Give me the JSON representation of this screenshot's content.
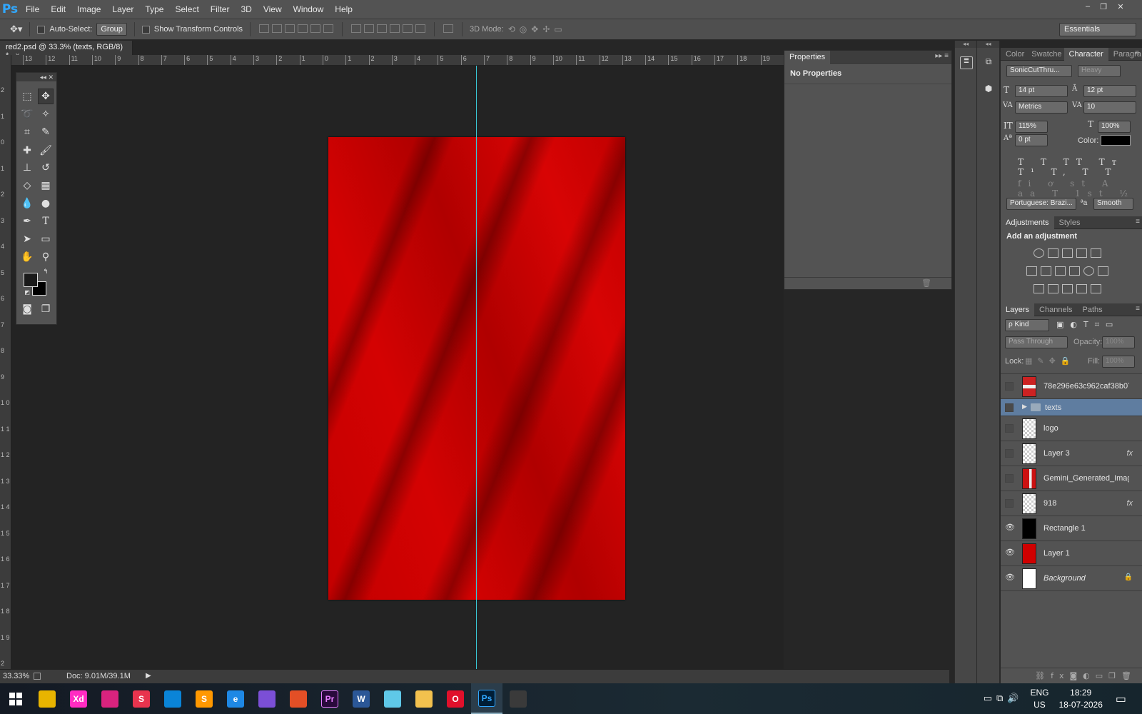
{
  "app": {
    "logo": "Ps"
  },
  "menu": [
    "File",
    "Edit",
    "Image",
    "Layer",
    "Type",
    "Select",
    "Filter",
    "3D",
    "View",
    "Window",
    "Help"
  ],
  "window_controls": {
    "minimize": "–",
    "restore": "❐",
    "close": "✕"
  },
  "options_bar": {
    "auto_select_label": "Auto-Select:",
    "auto_select_value": "Group",
    "show_transform_label": "Show Transform Controls",
    "mode_3d_label": "3D Mode:",
    "workspace": "Essentials"
  },
  "document_tab": {
    "title": "red2.psd @ 33.3% (texts, RGB/8) *",
    "close": "×"
  },
  "ruler_top": [
    "13",
    "12",
    "11",
    "10",
    "9",
    "8",
    "7",
    "6",
    "5",
    "4",
    "3",
    "2",
    "1",
    "0",
    "1",
    "2",
    "3",
    "4",
    "5",
    "6",
    "7",
    "8",
    "9",
    "10",
    "11",
    "12",
    "13",
    "14",
    "15",
    "16",
    "17",
    "18",
    "19"
  ],
  "ruler_left": [
    "2",
    "1",
    "0",
    "1",
    "2",
    "3",
    "4",
    "5",
    "6",
    "7",
    "8",
    "9",
    "1 0",
    "1 1",
    "1 2",
    "1 3",
    "1 4",
    "1 5",
    "1 6",
    "1 7",
    "1 8",
    "1 9",
    "2"
  ],
  "status": {
    "zoom": "33.33%",
    "doc": "Doc: 9.01M/39.1M"
  },
  "properties": {
    "tab": "Properties",
    "content": "No Properties"
  },
  "character_panel": {
    "tabs": [
      "Color",
      "Swatche",
      "Character",
      "Paragra"
    ],
    "font_family": "SonicCutThru...",
    "font_style": "Heavy",
    "font_size": "14 pt",
    "leading": "12 pt",
    "kerning": "Metrics",
    "tracking": "10",
    "vscale": "115%",
    "hscale": "100%",
    "baseline": "0 pt",
    "color_label": "Color:",
    "color_value": "#000000",
    "language": "Portuguese: Brazi...",
    "aa_label": "ªa",
    "antialias": "Smooth",
    "style_glyphs": "T T TT Tт T¹ T, T T",
    "ot_glyphs": "fi ơ st A aa T 1st ½"
  },
  "adjustments_panel": {
    "tabs": [
      "Adjustments",
      "Styles"
    ],
    "heading": "Add an adjustment"
  },
  "layers_panel": {
    "tabs": [
      "Layers",
      "Channels",
      "Paths"
    ],
    "filter_kind": "ρ Kind",
    "blend_mode": "Pass Through",
    "opacity_label": "Opacity:",
    "opacity_value": "100%",
    "lock_label": "Lock:",
    "fill_label": "Fill:",
    "fill_value": "100%",
    "layers": [
      {
        "name": "78e296e63c962caf38b07...",
        "visible": false,
        "thumb": "photo"
      },
      {
        "name": "texts",
        "visible": false,
        "thumb": "folder",
        "selected": true
      },
      {
        "name": "logo",
        "visible": false,
        "thumb": "transparent"
      },
      {
        "name": "Layer 3",
        "visible": false,
        "thumb": "transparent",
        "fx": "fx"
      },
      {
        "name": "Gemini_Generated_Imag...",
        "visible": false,
        "thumb": "photo2"
      },
      {
        "name": "918",
        "visible": false,
        "thumb": "transparent",
        "fx": "fx"
      },
      {
        "name": "Rectangle 1",
        "visible": true,
        "thumb": "black"
      },
      {
        "name": "Layer 1",
        "visible": true,
        "thumb": "red"
      },
      {
        "name": "Background",
        "visible": true,
        "thumb": "white",
        "locked": true
      }
    ]
  },
  "taskbar": {
    "apps": [
      {
        "label": "",
        "color": "#e8b400"
      },
      {
        "label": "Xd",
        "color": "#ff2bc2"
      },
      {
        "label": "",
        "color": "#d9237e"
      },
      {
        "label": "S",
        "color": "#e8344e"
      },
      {
        "label": "",
        "color": "#0a84d8"
      },
      {
        "label": "S",
        "color": "#ff9800"
      },
      {
        "label": "e",
        "color": "#1e88e5"
      },
      {
        "label": "",
        "color": "#7b4fd6"
      },
      {
        "label": "",
        "color": "#e34f26"
      },
      {
        "label": "Pr",
        "color": "#2a0a3c"
      },
      {
        "label": "W",
        "color": "#2b5797"
      },
      {
        "label": "",
        "color": "#5fc8e8"
      },
      {
        "label": "",
        "color": "#f2c14e"
      },
      {
        "label": "O",
        "color": "#e0102b"
      },
      {
        "label": "Ps",
        "color": "#001e36"
      },
      {
        "label": "",
        "color": "#3a3a3a"
      }
    ],
    "lang": "ENG",
    "region": "US",
    "time": "18:29",
    "date": "18-07-2026"
  }
}
